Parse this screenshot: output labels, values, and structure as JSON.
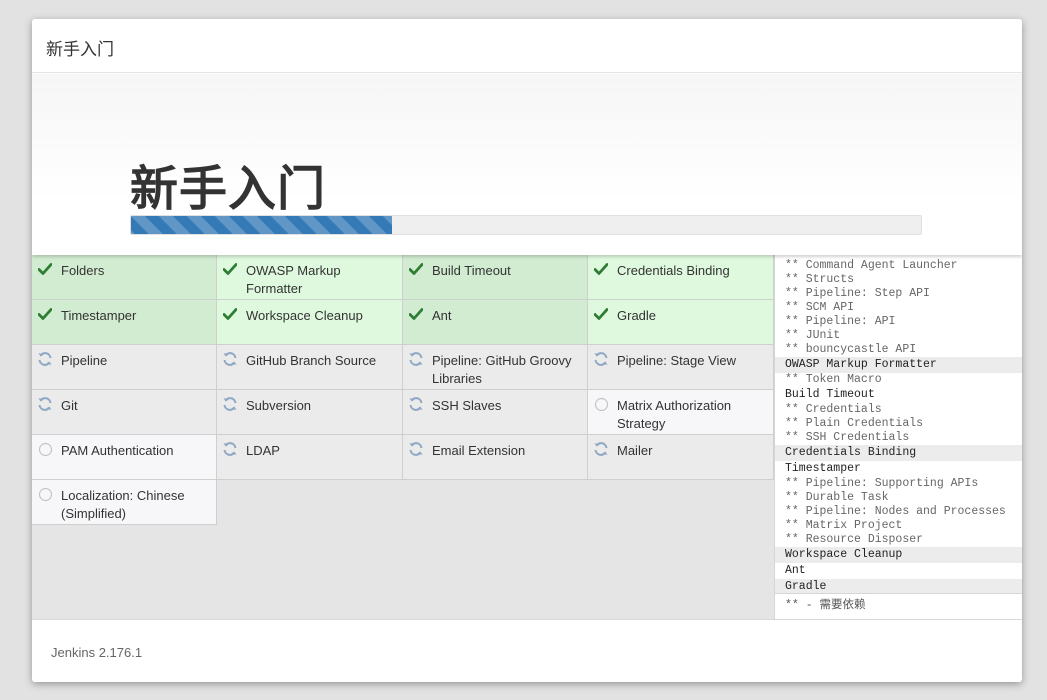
{
  "dialog": {
    "title": "新手入门"
  },
  "jumbotron": {
    "title": "新手入门",
    "progress_fraction": 0.33
  },
  "plugins": [
    {
      "name": "Folders",
      "status": "success"
    },
    {
      "name": "OWASP Markup Formatter",
      "status": "success"
    },
    {
      "name": "Build Timeout",
      "status": "success"
    },
    {
      "name": "Credentials Binding",
      "status": "success"
    },
    {
      "name": "Timestamper",
      "status": "success"
    },
    {
      "name": "Workspace Cleanup",
      "status": "success"
    },
    {
      "name": "Ant",
      "status": "success"
    },
    {
      "name": "Gradle",
      "status": "success"
    },
    {
      "name": "Pipeline",
      "status": "pending"
    },
    {
      "name": "GitHub Branch Source",
      "status": "pending"
    },
    {
      "name": "Pipeline: GitHub Groovy Libraries",
      "status": "pending"
    },
    {
      "name": "Pipeline: Stage View",
      "status": "pending"
    },
    {
      "name": "Git",
      "status": "pending"
    },
    {
      "name": "Subversion",
      "status": "pending"
    },
    {
      "name": "SSH Slaves",
      "status": "pending"
    },
    {
      "name": "Matrix Authorization Strategy",
      "status": "idle"
    },
    {
      "name": "PAM Authentication",
      "status": "idle"
    },
    {
      "name": "LDAP",
      "status": "pending"
    },
    {
      "name": "Email Extension",
      "status": "pending"
    },
    {
      "name": "Mailer",
      "status": "pending"
    },
    {
      "name": "Localization: Chinese (Simplified)",
      "status": "idle"
    }
  ],
  "log": {
    "lines": [
      {
        "text": "** Command Agent Launcher",
        "type": "dep"
      },
      {
        "text": "** Structs",
        "type": "dep"
      },
      {
        "text": "** Pipeline: Step API",
        "type": "dep"
      },
      {
        "text": "** SCM API",
        "type": "dep"
      },
      {
        "text": "** Pipeline: API",
        "type": "dep"
      },
      {
        "text": "** JUnit",
        "type": "dep"
      },
      {
        "text": "** bouncycastle API",
        "type": "dep"
      },
      {
        "text": "OWASP Markup Formatter",
        "type": "plugin"
      },
      {
        "text": "** Token Macro",
        "type": "dep"
      },
      {
        "text": "Build Timeout",
        "type": "plugin"
      },
      {
        "text": "** Credentials",
        "type": "dep"
      },
      {
        "text": "** Plain Credentials",
        "type": "dep"
      },
      {
        "text": "** SSH Credentials",
        "type": "dep"
      },
      {
        "text": "Credentials Binding",
        "type": "plugin"
      },
      {
        "text": "Timestamper",
        "type": "plugin"
      },
      {
        "text": "** Pipeline: Supporting APIs",
        "type": "dep"
      },
      {
        "text": "** Durable Task",
        "type": "dep"
      },
      {
        "text": "** Pipeline: Nodes and Processes",
        "type": "dep"
      },
      {
        "text": "** Matrix Project",
        "type": "dep"
      },
      {
        "text": "** Resource Disposer",
        "type": "dep"
      },
      {
        "text": "Workspace Cleanup",
        "type": "plugin"
      },
      {
        "text": "Ant",
        "type": "plugin"
      },
      {
        "text": "Gradle",
        "type": "plugin"
      }
    ],
    "footer": "** - 需要依赖"
  },
  "footer": {
    "version": "Jenkins 2.176.1"
  },
  "icons": {
    "success": "check-icon",
    "pending": "refresh-icon",
    "idle": "circle-icon"
  },
  "colors": {
    "success_icon": "#2e7d32",
    "pending_icon": "#8fa8c4",
    "progress": "#337ab7"
  }
}
